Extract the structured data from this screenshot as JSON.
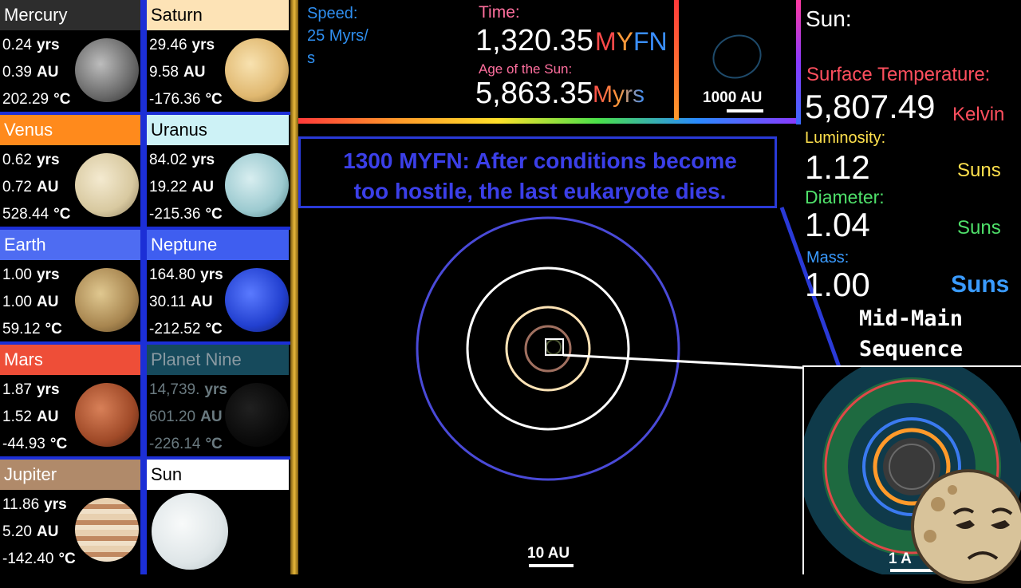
{
  "planets": [
    {
      "name": "Mercury",
      "period": "0.24",
      "period_unit": "yrs",
      "distance": "0.39",
      "distance_unit": "AU",
      "temp": "202.29",
      "temp_unit": "°C",
      "header_color": "#2d2d2d",
      "text_color": "#ffffff"
    },
    {
      "name": "Venus",
      "period": "0.62",
      "period_unit": "yrs",
      "distance": "0.72",
      "distance_unit": "AU",
      "temp": "528.44",
      "temp_unit": "°C",
      "header_color": "#ff8a1c",
      "text_color": "#ffffff"
    },
    {
      "name": "Earth",
      "period": "1.00",
      "period_unit": "yrs",
      "distance": "1.00",
      "distance_unit": "AU",
      "temp": "59.12",
      "temp_unit": "°C",
      "header_color": "#4e6cf2",
      "text_color": "#ffffff"
    },
    {
      "name": "Mars",
      "period": "1.87",
      "period_unit": "yrs",
      "distance": "1.52",
      "distance_unit": "AU",
      "temp": "-44.93",
      "temp_unit": "°C",
      "header_color": "#ee4e38",
      "text_color": "#ffffff"
    },
    {
      "name": "Jupiter",
      "period": "11.86",
      "period_unit": "yrs",
      "distance": "5.20",
      "distance_unit": "AU",
      "temp": "-142.40",
      "temp_unit": "°C",
      "header_color": "#b08a6a",
      "text_color": "#ffffff"
    },
    {
      "name": "Saturn",
      "period": "29.46",
      "period_unit": "yrs",
      "distance": "9.58",
      "distance_unit": "AU",
      "temp": "-176.36",
      "temp_unit": "°C",
      "header_color": "#fde3b6",
      "text_color": "#000000"
    },
    {
      "name": "Uranus",
      "period": "84.02",
      "period_unit": "yrs",
      "distance": "19.22",
      "distance_unit": "AU",
      "temp": "-215.36",
      "temp_unit": "°C",
      "header_color": "#cdf2f6",
      "text_color": "#000000"
    },
    {
      "name": "Neptune",
      "period": "164.80",
      "period_unit": "yrs",
      "distance": "30.11",
      "distance_unit": "AU",
      "temp": "-212.52",
      "temp_unit": "°C",
      "header_color": "#3f5ef0",
      "text_color": "#ffffff"
    },
    {
      "name": "Planet Nine",
      "period": "14,739.",
      "period_unit": "yrs",
      "distance": "601.20",
      "distance_unit": "AU",
      "temp": "-226.14",
      "temp_unit": "°C",
      "header_color": "#164a5c",
      "text_color": "#8a9aa2"
    },
    {
      "name": "Sun",
      "period": "",
      "period_unit": "",
      "distance": "",
      "distance_unit": "",
      "temp": "",
      "temp_unit": "",
      "header_color": "#ffffff",
      "text_color": "#000000"
    }
  ],
  "speed": {
    "label": "Speed:",
    "value": "25 Myrs/",
    "value2": "s"
  },
  "time": {
    "label": "Time:",
    "value": "1,320.35",
    "unit": "MYFN"
  },
  "age": {
    "label": "Age of the Sun:",
    "value": "5,863.35",
    "unit": "Myrs"
  },
  "minimap": {
    "scale_label": "1000 AU"
  },
  "event": {
    "line1": "1300 MYFN: After conditions become",
    "line2": "too hostile, the last eukaryote dies."
  },
  "main_view": {
    "scale_label": "10 AU"
  },
  "inset": {
    "scale_label": "1 A"
  },
  "sun_panel": {
    "title": "Sun:",
    "temp_label": "Surface Temperature:",
    "temp_value": "5,807.49",
    "temp_unit": "Kelvin",
    "lum_label": "Luminosity:",
    "lum_value": "1.12",
    "lum_unit": "Suns",
    "diam_label": "Diameter:",
    "diam_value": "1.04",
    "diam_unit": "Suns",
    "mass_label": "Mass:",
    "mass_value": "1.00",
    "mass_unit": "Suns",
    "stage_line1": "Mid-Main",
    "stage_line2": "Sequence"
  },
  "colors": {
    "speed": "#2f8ff0",
    "time_label": "#ff6f9e",
    "myfn_m": "#ff4a4a",
    "myfn_y": "#ff9a3a",
    "myfn_fn": "#3a8fff",
    "age_label": "#ff6f9e",
    "temp_label": "#ff4f5e",
    "lum_label": "#ffe14d",
    "diam_label": "#4fe06a",
    "mass_label": "#3a9bff",
    "event_text": "#3b3fe8",
    "separator": "#1c2fd6"
  },
  "icons": [
    "character-face-icon"
  ]
}
